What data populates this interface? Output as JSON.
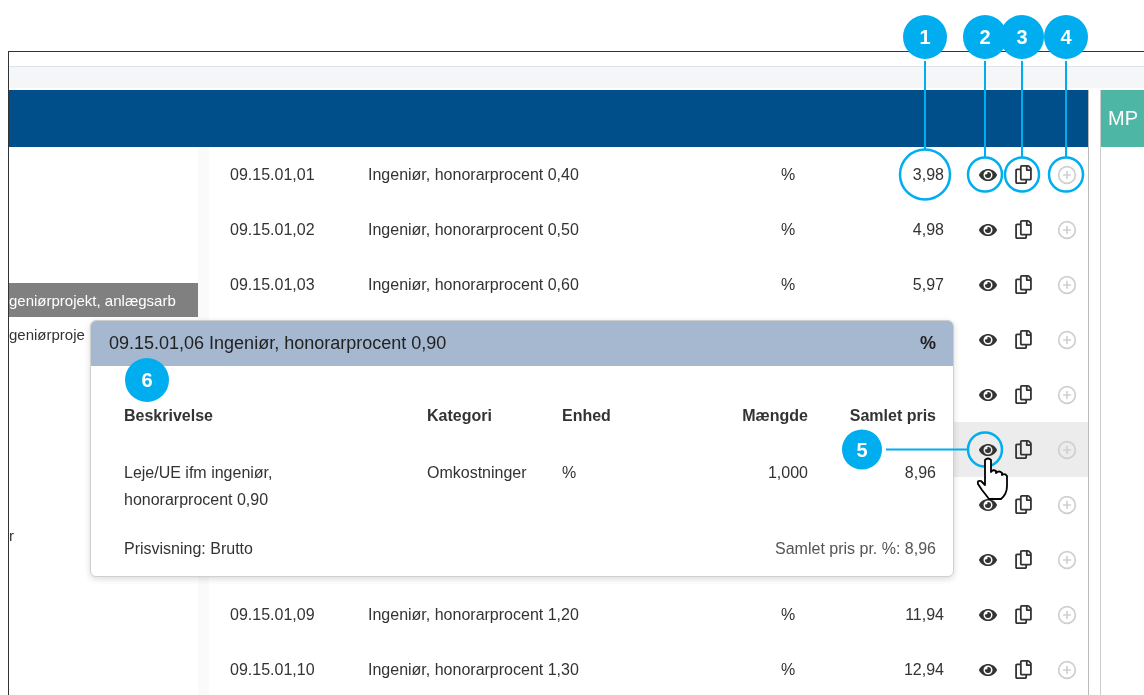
{
  "header_tab": {
    "label": "MP"
  },
  "sidebar": {
    "items": [
      {
        "label": "geniørprojekt, anlægsarb",
        "selected": true
      },
      {
        "label": "geniørproje",
        "selected": false
      },
      {
        "label": "r",
        "selected": false
      }
    ]
  },
  "table": {
    "rows": [
      {
        "code": "09.15.01,01",
        "description": "Ingeniør, honorarprocent 0,40",
        "unit": "%",
        "price": "3,98",
        "selected": false,
        "add_disabled": true
      },
      {
        "code": "09.15.01,02",
        "description": "Ingeniør, honorarprocent 0,50",
        "unit": "%",
        "price": "4,98",
        "selected": false,
        "add_disabled": true
      },
      {
        "code": "09.15.01,03",
        "description": "Ingeniør, honorarprocent 0,60",
        "unit": "%",
        "price": "5,97",
        "selected": false,
        "add_disabled": true
      },
      {
        "selected": false,
        "add_disabled": true
      },
      {
        "selected": false,
        "add_disabled": true
      },
      {
        "selected": true,
        "add_disabled": true
      },
      {
        "selected": false,
        "add_disabled": true
      },
      {
        "selected": false,
        "add_disabled": true
      },
      {
        "code": "09.15.01,09",
        "description": "Ingeniør, honorarprocent 1,20",
        "unit": "%",
        "price": "11,94",
        "selected": false,
        "add_disabled": true
      },
      {
        "code": "09.15.01,10",
        "description": "Ingeniør, honorarprocent 1,30",
        "unit": "%",
        "price": "12,94",
        "selected": false,
        "add_disabled": true
      }
    ]
  },
  "popover": {
    "title": "09.15.01,06 Ingeniør, honorarprocent 0,90",
    "unit": "%",
    "columns": [
      "Beskrivelse",
      "Kategori",
      "Enhed",
      "Mængde",
      "Samlet pris"
    ],
    "rows": [
      {
        "cells": [
          "Leje/UE ifm ingeniør, honorarprocent 0,90",
          "Omkostninger",
          "%",
          "1,000",
          "8,96"
        ]
      }
    ],
    "price_view": "Prisvisning: Brutto",
    "total": "Samlet pris pr. %: 8,96"
  },
  "callouts": [
    {
      "label": "1"
    },
    {
      "label": "2"
    },
    {
      "label": "3"
    },
    {
      "label": "4"
    },
    {
      "label": "5"
    },
    {
      "label": "6"
    }
  ]
}
